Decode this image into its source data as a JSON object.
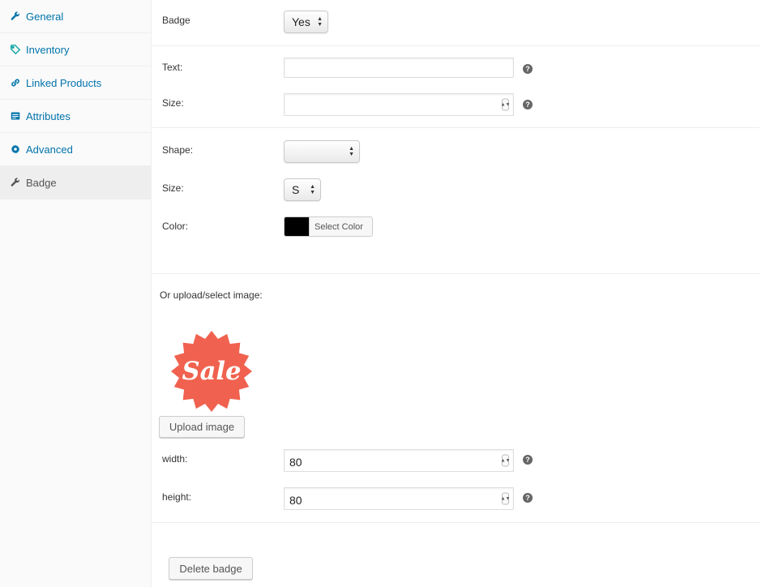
{
  "sidebar": {
    "items": [
      {
        "label": "General",
        "icon": "wrench-icon"
      },
      {
        "label": "Inventory",
        "icon": "tag-icon"
      },
      {
        "label": "Linked Products",
        "icon": "link-icon"
      },
      {
        "label": "Attributes",
        "icon": "list-icon"
      },
      {
        "label": "Advanced",
        "icon": "gear-icon"
      },
      {
        "label": "Badge",
        "icon": "wrench-icon",
        "active": true
      }
    ]
  },
  "badge": {
    "label": "Badge",
    "selected": "Yes"
  },
  "text_section": {
    "text_label": "Text:",
    "text_value": "",
    "size_label": "Size:",
    "size_value": "",
    "help_glyph": "?"
  },
  "shape_section": {
    "shape_label": "Shape:",
    "shape_selected": "",
    "size_label": "Size:",
    "size_selected": "S",
    "color_label": "Color:",
    "color_value": "#000000",
    "select_color_label": "Select Color"
  },
  "image_section": {
    "heading": "Or upload/select image:",
    "image_text": "Sale",
    "image_color": "#f0624f",
    "upload_label": "Upload image",
    "width_label": "width:",
    "width_value": "80",
    "height_label": "height:",
    "height_value": "80"
  },
  "footer": {
    "delete_label": "Delete badge"
  },
  "colors": {
    "link": "#0073aa",
    "sidebar_bg": "#fafafa",
    "active_tab_bg": "#eeeeee"
  }
}
